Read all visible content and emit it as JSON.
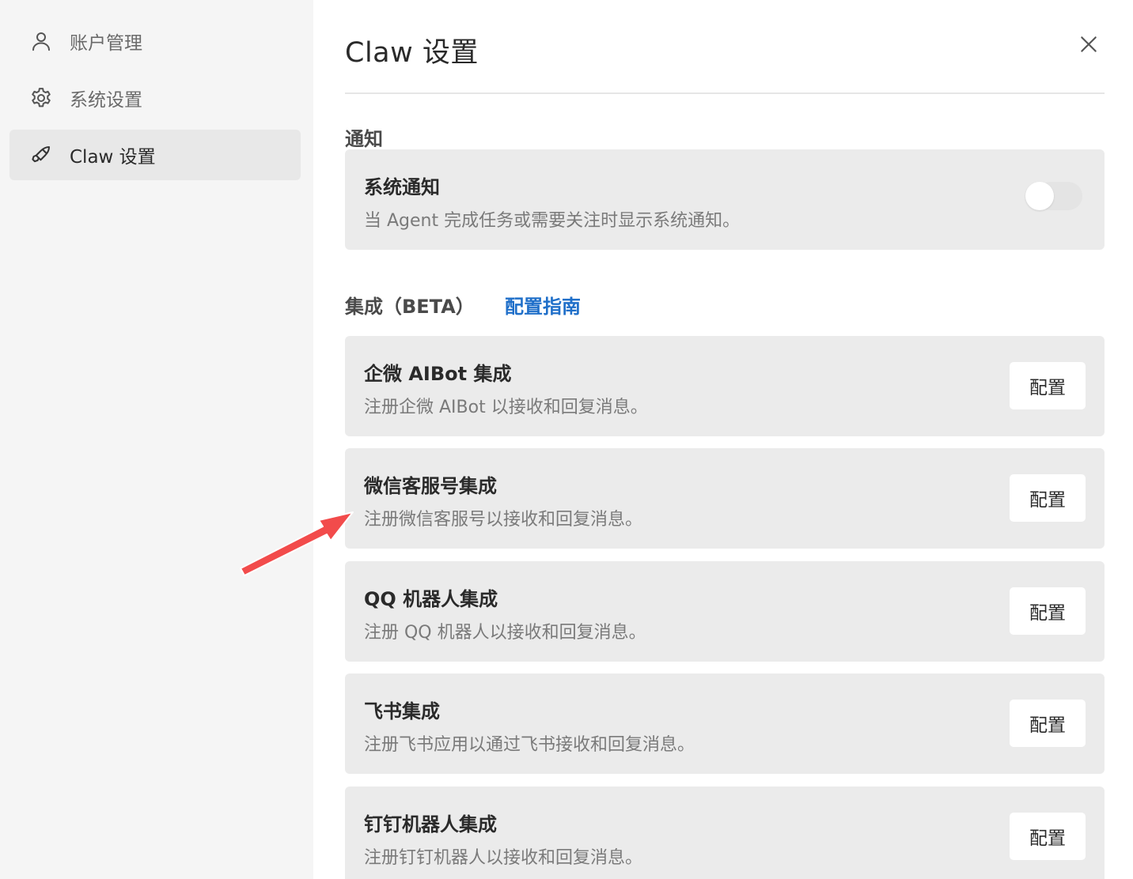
{
  "sidebar": {
    "items": [
      {
        "label": "账户管理",
        "icon": "user-icon",
        "active": false
      },
      {
        "label": "系统设置",
        "icon": "gear-icon",
        "active": false
      },
      {
        "label": "Claw 设置",
        "icon": "claw-icon",
        "active": true
      }
    ]
  },
  "header": {
    "title": "Claw 设置"
  },
  "notifications": {
    "section_title": "通知",
    "card": {
      "title": "系统通知",
      "description": "当 Agent 完成任务或需要关注时显示系统通知。",
      "toggle_on": false
    }
  },
  "integrations": {
    "section_title": "集成（BETA）",
    "guide_link": "配置指南",
    "cards": [
      {
        "title": "企微 AIBot 集成",
        "description": "注册企微 AIBot 以接收和回复消息。",
        "button": "配置"
      },
      {
        "title": "微信客服号集成",
        "description": "注册微信客服号以接收和回复消息。",
        "button": "配置"
      },
      {
        "title": "QQ 机器人集成",
        "description": "注册 QQ 机器人以接收和回复消息。",
        "button": "配置"
      },
      {
        "title": "飞书集成",
        "description": "注册飞书应用以通过飞书接收和回复消息。",
        "button": "配置"
      },
      {
        "title": "钉钉机器人集成",
        "description": "注册钉钉机器人以接收和回复消息。",
        "button": "配置"
      }
    ]
  },
  "colors": {
    "accent_link": "#1f6fc9",
    "annotation_arrow": "#f24b4b",
    "sidebar_bg": "#f5f5f5",
    "card_bg": "#ebebeb"
  }
}
